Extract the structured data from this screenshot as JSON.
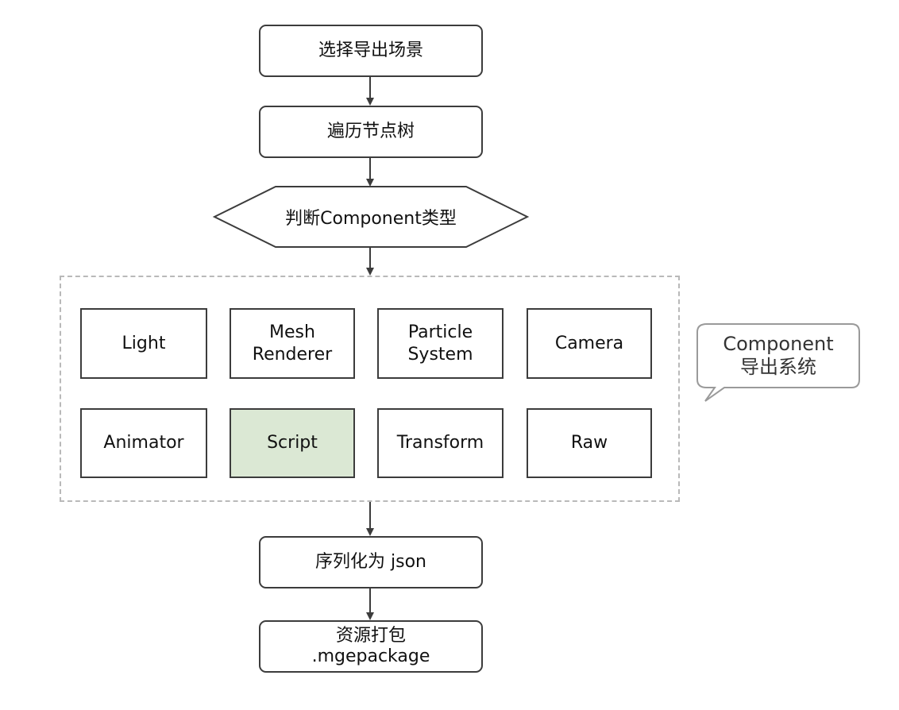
{
  "flow": {
    "step1": "选择导出场景",
    "step2": "遍历节点树",
    "decision": "判断Component类型",
    "step4": "序列化为 json",
    "step5": "资源打包\n.mgepackage"
  },
  "components": {
    "row1": [
      "Light",
      "Mesh\nRenderer",
      "Particle\nSystem",
      "Camera"
    ],
    "row2": [
      "Animator",
      "Script",
      "Transform",
      "Raw"
    ]
  },
  "callout": "Component\n导出系统",
  "colors": {
    "stroke": "#3c3c3c",
    "dashed_border": "#b9b9b9",
    "highlight_fill": "#dbe8d4",
    "callout_border": "#9a9a9a"
  }
}
